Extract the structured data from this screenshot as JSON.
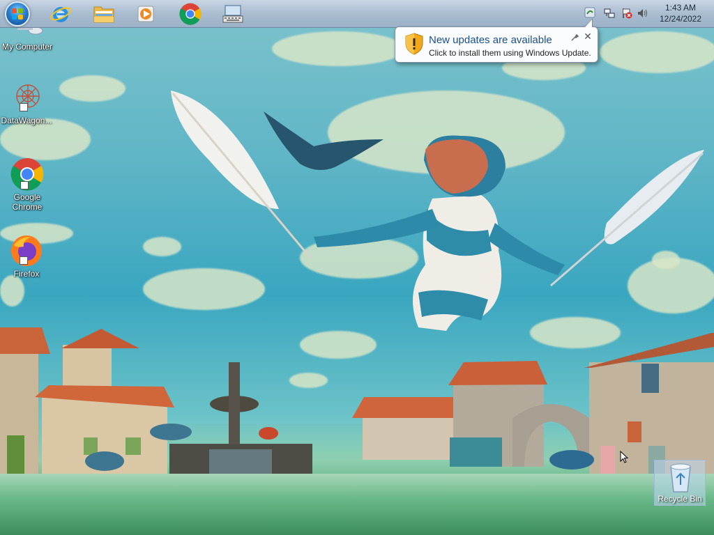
{
  "taskbar": {
    "pinned": [
      {
        "name": "start-orb",
        "icon": "windows-flag-icon"
      },
      {
        "name": "internet-explorer",
        "icon": "internet-explorer-icon"
      },
      {
        "name": "file-explorer",
        "icon": "folder-icon"
      },
      {
        "name": "media-player",
        "icon": "media-player-icon"
      },
      {
        "name": "google-chrome",
        "icon": "chrome-icon"
      },
      {
        "name": "on-screen-keyboard",
        "icon": "keyboard-icon"
      }
    ],
    "tray": [
      "windows-update-icon",
      "network-icon",
      "action-center-icon",
      "volume-icon"
    ],
    "clock": {
      "time": "1:43 AM",
      "date": "12/24/2022"
    }
  },
  "notification": {
    "title": "New updates are available",
    "body": "Click to install them using Windows Update.",
    "icon": "shield-warning-icon"
  },
  "desktop": {
    "icons": [
      {
        "label": "My Computer",
        "icon": "computer-icon"
      },
      {
        "label": "DataWagon...",
        "icon": "datawagon-icon"
      },
      {
        "label": "Google Chrome",
        "icon": "chrome-icon"
      },
      {
        "label": "Firefox",
        "icon": "firefox-icon"
      }
    ],
    "recycle_bin": {
      "label": "Recycle Bin",
      "icon": "recycle-bin-icon"
    }
  },
  "colors": {
    "taskbar": "#a9bcd0",
    "notification_title": "#1a4f94",
    "sky": "#3aa6c0"
  }
}
